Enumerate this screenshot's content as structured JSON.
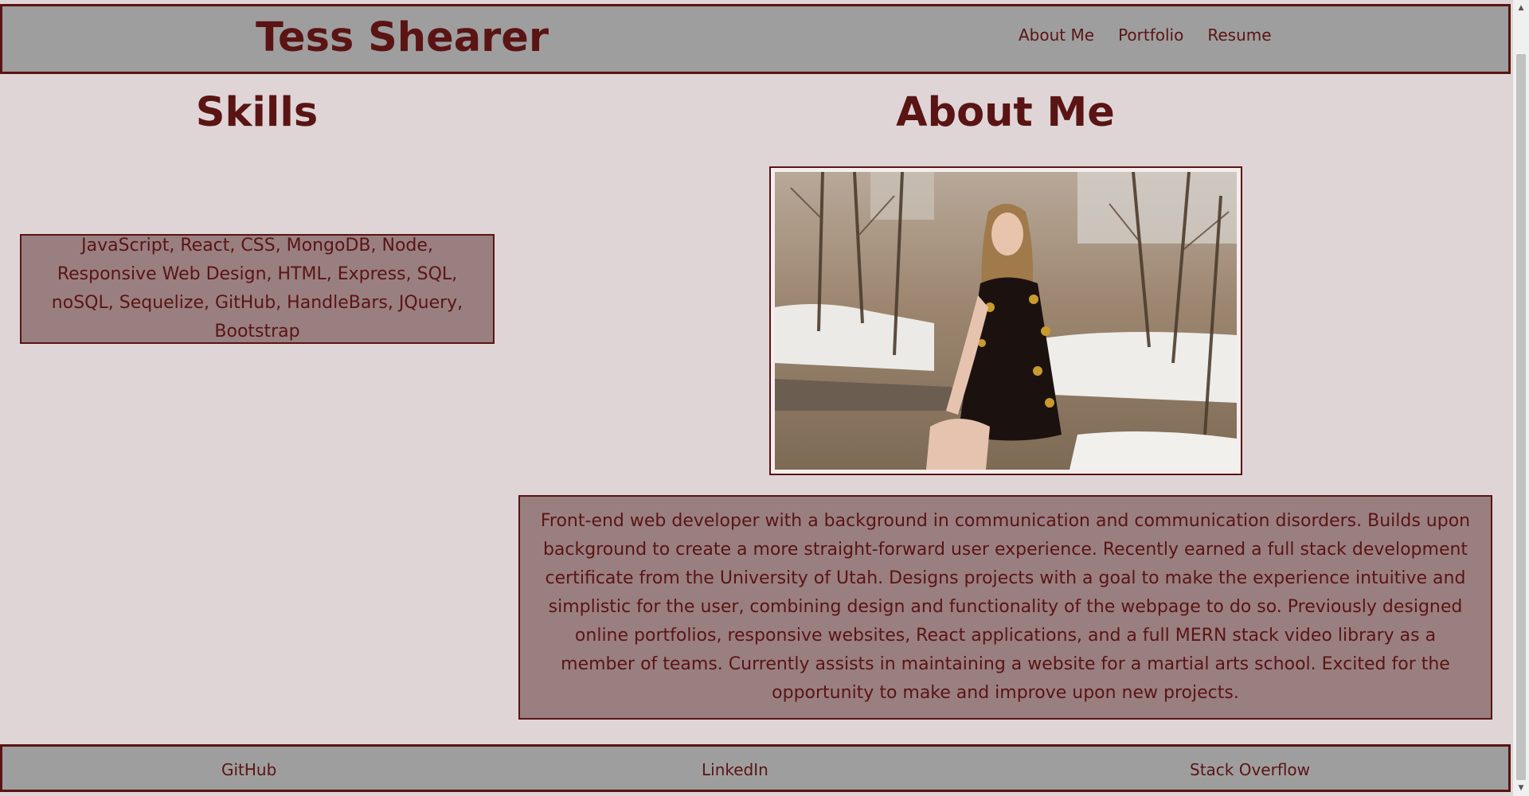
{
  "header": {
    "title": "Tess Shearer",
    "nav": [
      {
        "label": "About Me"
      },
      {
        "label": "Portfolio"
      },
      {
        "label": "Resume"
      }
    ]
  },
  "skills": {
    "heading": "Skills",
    "text": "JavaScript, React, CSS, MongoDB, Node, Responsive Web Design, HTML, Express, SQL, noSQL, Sequelize, GitHub, HandleBars, JQuery, Bootstrap"
  },
  "about": {
    "heading": "About Me",
    "photo_icon": "profile-photo",
    "bio": "Front-end web developer with a background in communication and communication disorders. Builds upon background to create a more straight-forward user experience. Recently earned a full stack development certificate from the University of Utah. Designs projects with a goal to make the experience intuitive and simplistic for the user, combining design and functionality of the webpage to do so. Previously designed online portfolios, responsive websites, React applications, and a full MERN stack video library as a member of teams. Currently assists in maintaining a website for a martial arts school. Excited for the opportunity to make and improve upon new projects."
  },
  "footer": {
    "links": [
      {
        "label": "GitHub"
      },
      {
        "label": "LinkedIn"
      },
      {
        "label": "Stack Overflow"
      }
    ]
  },
  "colors": {
    "accent": "#5a1414",
    "header_bg": "#9f9e9e",
    "page_bg": "#dfd5d6",
    "box_bg": "#9a7f81"
  }
}
